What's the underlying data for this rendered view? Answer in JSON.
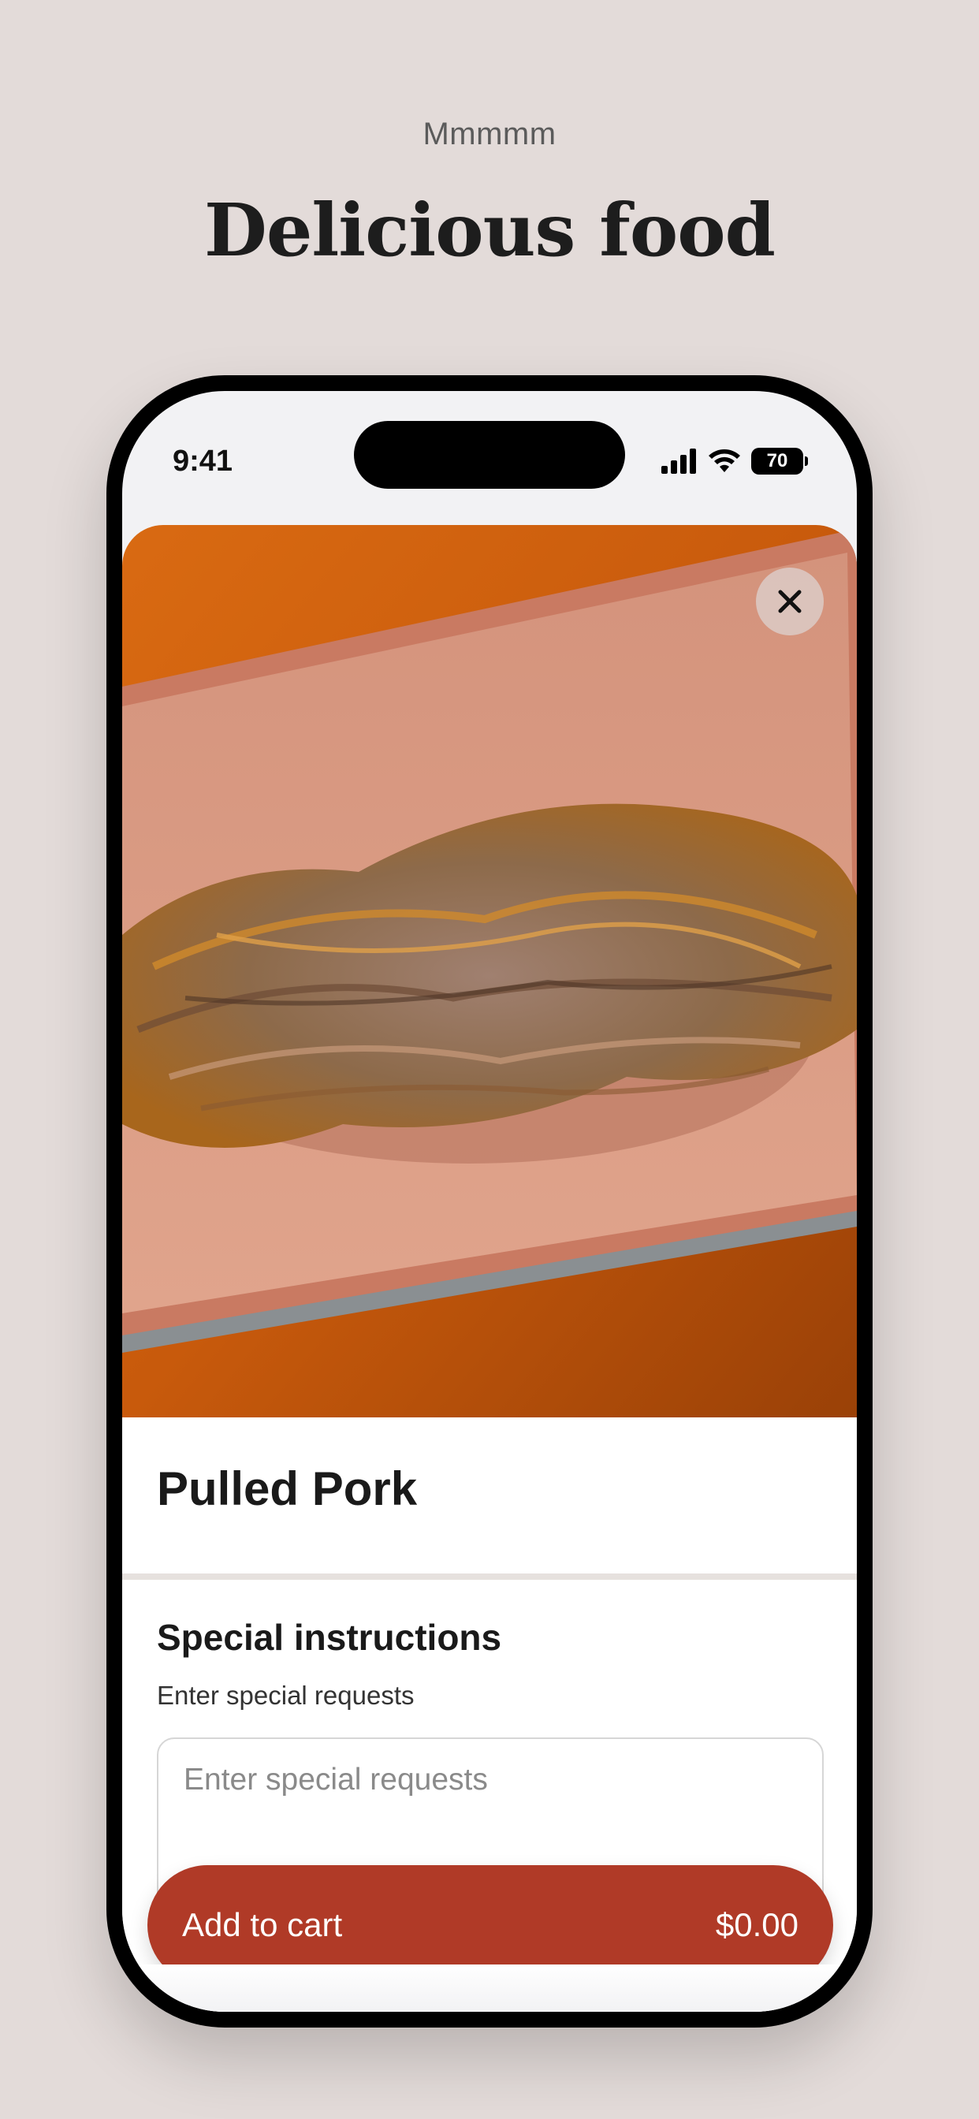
{
  "intro": {
    "eyebrow": "Mmmmm",
    "headline": "Delicious food"
  },
  "status_bar": {
    "time": "9:41",
    "battery": "70"
  },
  "product": {
    "name": "Pulled Pork",
    "image_icon": "pulled-pork-photo"
  },
  "instructions": {
    "title": "Special instructions",
    "subtitle": "Enter special requests",
    "placeholder": "Enter special requests",
    "value": ""
  },
  "cart": {
    "label": "Add to cart",
    "price": "$0.00"
  },
  "colors": {
    "background": "#e3dbd9",
    "accent": "#b03a27"
  }
}
